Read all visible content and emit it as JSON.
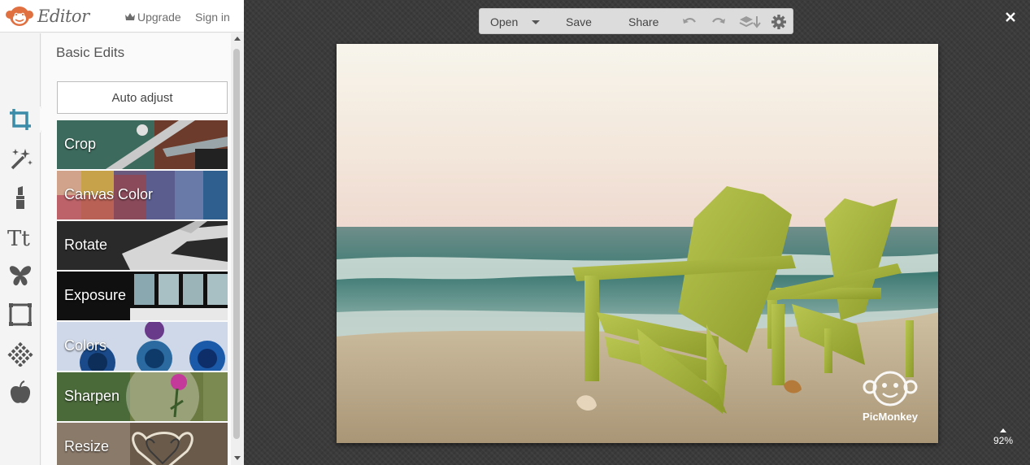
{
  "app": {
    "title": "Editor",
    "upgrade_label": "Upgrade",
    "signin_label": "Sign in",
    "accent_color": "#e07040"
  },
  "rail": {
    "icons": [
      "crop-icon",
      "magic-wand-icon",
      "lipstick-icon",
      "text-icon",
      "butterfly-icon",
      "frame-icon",
      "texture-icon",
      "apple-icon"
    ],
    "active": "crop-icon"
  },
  "panel": {
    "title": "Basic Edits",
    "auto_adjust_label": "Auto adjust",
    "items": [
      {
        "label": "Crop"
      },
      {
        "label": "Canvas Color"
      },
      {
        "label": "Rotate"
      },
      {
        "label": "Exposure"
      },
      {
        "label": "Colors"
      },
      {
        "label": "Sharpen"
      },
      {
        "label": "Resize"
      }
    ]
  },
  "toolbar": {
    "open_label": "Open",
    "save_label": "Save",
    "share_label": "Share",
    "icons": [
      "undo-icon",
      "redo-icon",
      "layers-icon",
      "gear-icon"
    ]
  },
  "canvas": {
    "watermark_text": "PicMonkey",
    "zoom": "92%"
  }
}
